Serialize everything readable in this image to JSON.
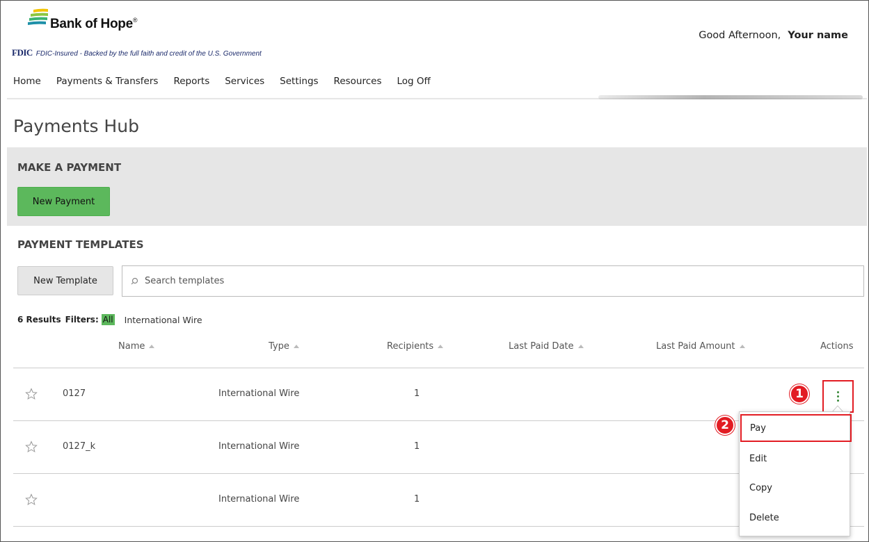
{
  "header": {
    "brand_name": "Bank of Hope",
    "brand_mark": "®",
    "fdic_logo": "FDIC",
    "fdic_text": "FDIC-Insured - Backed by the full faith and credit of the U.S. Government",
    "greeting": "Good Afternoon,",
    "user_name": "Your name"
  },
  "nav": {
    "items": [
      "Home",
      "Payments & Transfers",
      "Reports",
      "Services",
      "Settings",
      "Resources",
      "Log Off"
    ]
  },
  "page": {
    "title": "Payments Hub"
  },
  "make_payment": {
    "title": "MAKE A PAYMENT",
    "button_label": "New Payment"
  },
  "templates": {
    "title": "PAYMENT TEMPLATES",
    "new_template_label": "New Template",
    "search_placeholder": "Search templates",
    "results": "6 Results",
    "filters_label": "Filters:",
    "filter_all": "All",
    "filter_wire": "International Wire",
    "columns": [
      "Name",
      "Type",
      "Recipients",
      "Last Paid Date",
      "Last Paid Amount",
      "Actions"
    ],
    "rows": [
      {
        "name": "0127",
        "type": "International Wire",
        "recipients": "1"
      },
      {
        "name": "0127_k",
        "type": "International Wire",
        "recipients": "1"
      },
      {
        "name": "",
        "type": "International Wire",
        "recipients": "1"
      }
    ]
  },
  "actions_menu": {
    "items": [
      "Pay",
      "Edit",
      "Copy",
      "Delete"
    ]
  },
  "callouts": [
    "1",
    "2"
  ],
  "colors": {
    "accent_green": "#5cb85c",
    "callout_red": "#e21c23",
    "panel_gray": "#e6e6e6"
  },
  "icons": {
    "logo": "bank-of-hope-logo-icon",
    "search": "search-icon",
    "star": "star-outline-icon",
    "actions": "kebab-menu-icon",
    "sort": "sort-ascending-icon"
  }
}
